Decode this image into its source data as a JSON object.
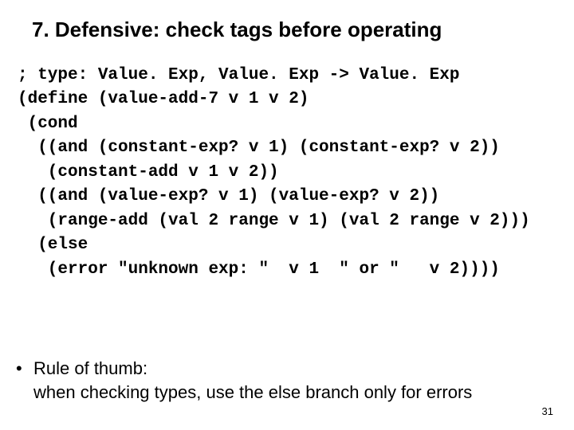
{
  "title": "7. Defensive: check tags before operating",
  "code": {
    "l1": "; type: Value. Exp, Value. Exp -> Value. Exp",
    "l2": "(define (value-add-7 v 1 v 2)",
    "l3": " (cond",
    "l4": "  ((and (constant-exp? v 1) (constant-exp? v 2))",
    "l5": "   (constant-add v 1 v 2))",
    "l6": "  ((and (value-exp? v 1) (value-exp? v 2))",
    "l7": "   (range-add (val 2 range v 1) (val 2 range v 2)))",
    "l8": "  (else",
    "l9": "   (error \"unknown exp: \"  v 1  \" or \"   v 2))))"
  },
  "bullet": {
    "dot": "•",
    "line1": "Rule of thumb:",
    "line2": "when checking types, use the else branch only for errors"
  },
  "page_number": "31"
}
